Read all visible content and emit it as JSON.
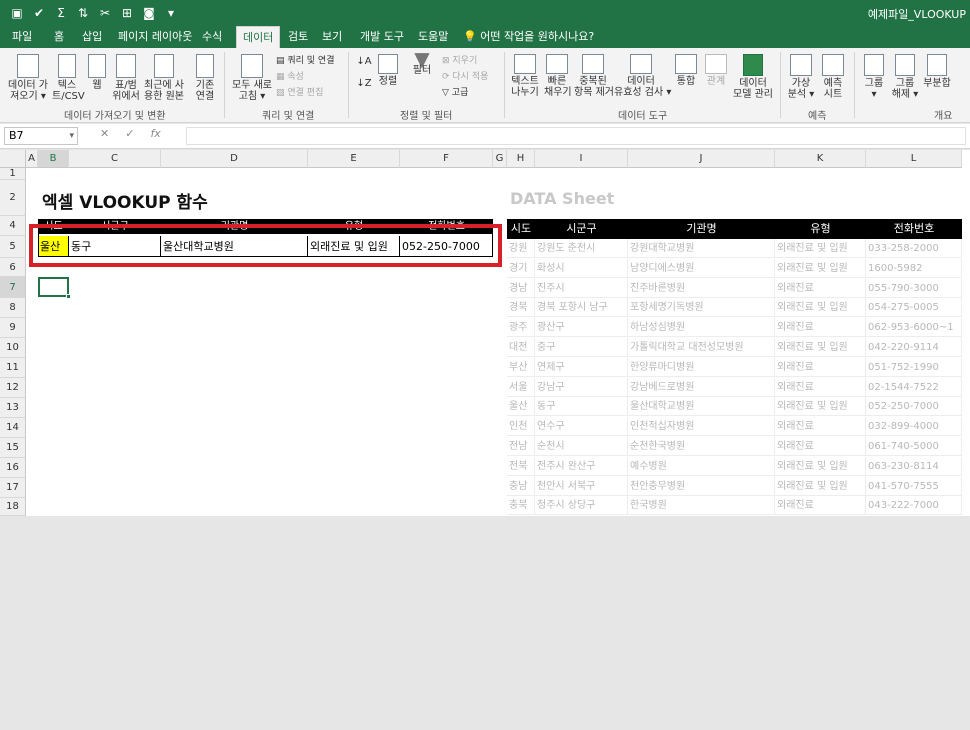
{
  "titlebar": {
    "qat": [
      "save-icon",
      "check-icon",
      "sum-icon",
      "sort-icon",
      "cut-icon",
      "filter-icon",
      "camera-icon",
      "more-icon"
    ],
    "qat_glyphs": [
      "▣",
      "✔",
      "Σ",
      "⇅",
      "✂",
      "⊞",
      "◙",
      "▾"
    ],
    "doc_title": "예제파일_VLOOKUP"
  },
  "tabs": [
    "파일",
    "홈",
    "삽입",
    "페이지 레이아웃",
    "수식",
    "데이터",
    "검토",
    "보기",
    "개발 도구",
    "도움말"
  ],
  "active_tab": "데이터",
  "tell_me": "어떤 작업을 원하시나요?",
  "ribbon": {
    "get_data_line1": "데이터 가",
    "get_data_line2": "져오기 ▾",
    "text_csv_line1": "텍스",
    "text_csv_line2": "트/CSV",
    "web": "웹",
    "from_table_line1": "표/범",
    "from_table_line2": "위에서",
    "recent_line1": "최근에 사",
    "recent_line2": "용한 원본",
    "existing_line1": "기존",
    "existing_line2": "연결",
    "group1_label": "데이터 가져오기 및 변환",
    "refresh_line1": "모두 새로",
    "refresh_line2": "고침 ▾",
    "queries": "쿼리 및 연결",
    "properties": "속성",
    "edit_links": "연결 편집",
    "group2_label": "쿼리 및 연결",
    "sort": "정렬",
    "filter": "필터",
    "clear": "지우기",
    "reapply": "다시 적용",
    "advanced": "고급",
    "group3_label": "정렬 및 필터",
    "text_to_cols_line1": "텍스트",
    "text_to_cols_line2": "나누기",
    "flash_fill_line1": "빠른",
    "flash_fill_line2": "채우기",
    "remove_dup_line1": "중복된",
    "remove_dup_line2": "항목 제거",
    "validation_line1": "데이터",
    "validation_line2": "유효성 검사 ▾",
    "consolidate": "통합",
    "relations": "관계",
    "data_model_line1": "데이터",
    "data_model_line2": "모델 관리",
    "group4_label": "데이터 도구",
    "whatif_line1": "가상",
    "whatif_line2": "분석 ▾",
    "forecast_line1": "예측",
    "forecast_line2": "시트",
    "group5_label": "예측",
    "group_line1": "그룹",
    "group_line2": "▾",
    "ungroup_line1": "그룹",
    "ungroup_line2": "해제 ▾",
    "subtotal": "부분합",
    "group6_label": "개요"
  },
  "formula_bar": {
    "name_box": "B7",
    "name_box_arrow": "▾",
    "cancel": "✕",
    "enter": "✓",
    "fx": "fx",
    "value": ""
  },
  "columns": [
    "A",
    "B",
    "C",
    "D",
    "E",
    "F",
    "G",
    "H",
    "I",
    "J",
    "K",
    "L"
  ],
  "rows": [
    "1",
    "2",
    "4",
    "5",
    "6",
    "7",
    "8",
    "9",
    "10",
    "11",
    "12",
    "13",
    "14",
    "15",
    "16",
    "17",
    "18"
  ],
  "selected_col": "B",
  "selected_row": "7",
  "sheet_title": "엑셀 VLOOKUP 함수",
  "lookup_table": {
    "headers": [
      "시도",
      "시군구",
      "기관명",
      "유형",
      "전화번호"
    ],
    "row": [
      "울산",
      "동구",
      "울산대학교병원",
      "외래진료 및 입원",
      "052-250-7000"
    ]
  },
  "data_sheet": {
    "title": "DATA Sheet",
    "headers": [
      "시도",
      "시군구",
      "기관명",
      "유형",
      "전화번호"
    ],
    "rows": [
      [
        "강원",
        "강원도 춘천시",
        "강원대학교병원",
        "외래진료 및 입원",
        "033-258-2000"
      ],
      [
        "경기",
        "화성시",
        "남양디에스병원",
        "외래진료 및 입원",
        "1600-5982"
      ],
      [
        "경남",
        "진주시",
        "진주바른병원",
        "외래진료",
        "055-790-3000"
      ],
      [
        "경북",
        "경북 포항시 남구",
        "포항세명기독병원",
        "외래진료 및 입원",
        "054-275-0005"
      ],
      [
        "광주",
        "광산구",
        "하남성심병원",
        "외래진료",
        "062-953-6000~1"
      ],
      [
        "대전",
        "중구",
        "가톨릭대학교 대전성모병원",
        "외래진료 및 입원",
        "042-220-9114"
      ],
      [
        "부산",
        "연제구",
        "한양류마디병원",
        "외래진료",
        "051-752-1990"
      ],
      [
        "서울",
        "강남구",
        "강남베드로병원",
        "외래진료",
        "02-1544-7522"
      ],
      [
        "울산",
        "동구",
        "울산대학교병원",
        "외래진료 및 입원",
        "052-250-7000"
      ],
      [
        "인천",
        "연수구",
        "인천적십자병원",
        "외래진료",
        "032-899-4000"
      ],
      [
        "전남",
        "순천시",
        "순천한국병원",
        "외래진료",
        "061-740-5000"
      ],
      [
        "전북",
        "전주시 완산구",
        "예수병원",
        "외래진료 및 입원",
        "063-230-8114"
      ],
      [
        "충남",
        "천안시 서북구",
        "천안충무병원",
        "외래진료 및 입원",
        "041-570-7555"
      ],
      [
        "충북",
        "청주시 상당구",
        "한국병원",
        "외래진료",
        "043-222-7000"
      ]
    ]
  },
  "colors": {
    "excel_green": "#217346",
    "highlight": "#ffff00",
    "callout_red": "#d72027"
  }
}
